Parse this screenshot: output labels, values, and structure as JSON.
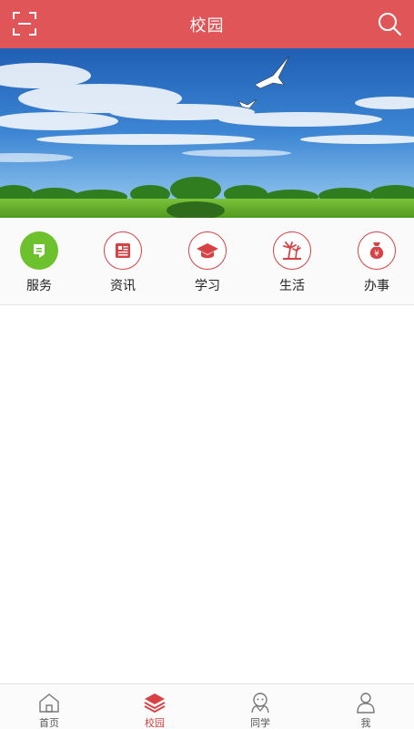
{
  "header": {
    "title": "校园",
    "scan_icon": "scan-icon",
    "search_icon": "search-icon"
  },
  "menu": {
    "items": [
      {
        "label": "服务",
        "icon": "service-chat-icon"
      },
      {
        "label": "资讯",
        "icon": "news-icon"
      },
      {
        "label": "学习",
        "icon": "graduation-cap-icon"
      },
      {
        "label": "生活",
        "icon": "beach-life-icon"
      },
      {
        "label": "办事",
        "icon": "money-bag-icon"
      }
    ]
  },
  "tabbar": {
    "items": [
      {
        "label": "首页",
        "icon": "home-icon"
      },
      {
        "label": "校园",
        "icon": "layers-icon"
      },
      {
        "label": "同学",
        "icon": "classmates-icon"
      },
      {
        "label": "我",
        "icon": "user-icon"
      }
    ],
    "active": "校园"
  },
  "colors": {
    "header_bg": "#E05557",
    "accent": "#D74245",
    "service_green": "#6CC12C"
  }
}
